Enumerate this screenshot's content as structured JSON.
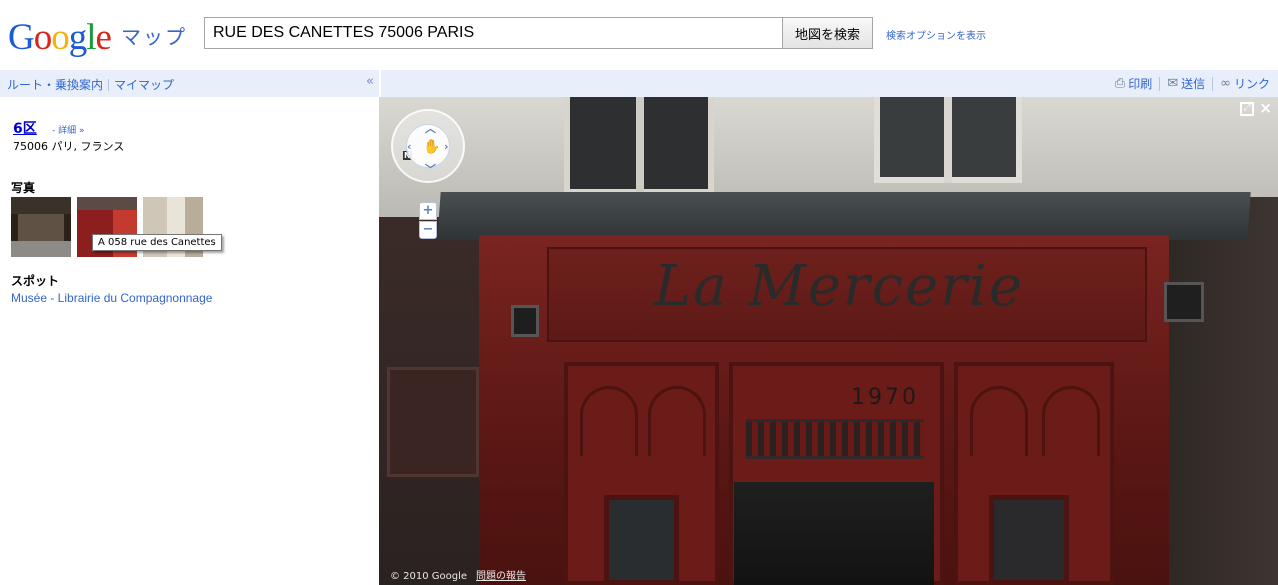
{
  "header": {
    "logo_text": "Google",
    "logo_sub": "マップ",
    "search_value": "RUE DES CANETTES 75006 PARIS",
    "search_button": "地図を検索",
    "search_options": "検索オプションを表示"
  },
  "toolbar": {
    "route_link": "ルート・乗換案内",
    "mymaps_link": "マイマップ",
    "collapse": "«",
    "print": "印刷",
    "send": "送信",
    "link": "リンク"
  },
  "panel": {
    "place_title": "6区",
    "details": "- 詳細 »",
    "address": "75006 パリ, フランス",
    "photos_heading": "写真",
    "photo_tooltip": "A 058 rue des Canettes",
    "spots_heading": "スポット",
    "spot_link": "Musée - Librairie du Compagnonnage"
  },
  "streetview": {
    "shop_name": "La Mercerie",
    "year": "1970",
    "copyright": "© 2010 Google",
    "report": "問題の報告",
    "compass_n": "N",
    "zoom_in": "+",
    "zoom_out": "−"
  },
  "colors": {
    "link_blue": "#3366cc",
    "toolbar_bg": "#e8eefa",
    "storefront_red": "#7a2420"
  },
  "icons": {
    "print": "printer-icon",
    "send": "envelope-icon",
    "link": "chain-link-icon",
    "pan": "hand-icon",
    "fullscreen": "fullscreen-icon",
    "close": "close-icon"
  }
}
